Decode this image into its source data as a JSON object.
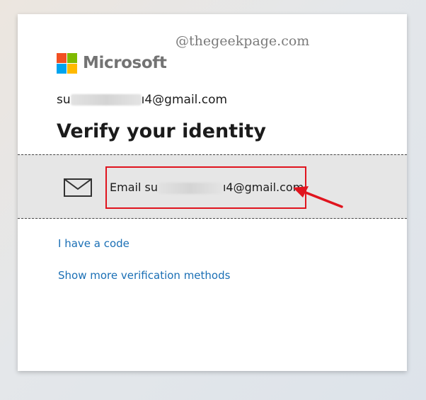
{
  "brand": {
    "name": "Microsoft"
  },
  "watermark": "@thegeekpage.com",
  "account": {
    "prefix": "su",
    "suffix": "ı4@gmail.com"
  },
  "title": "Verify your identity",
  "option": {
    "label_prefix": "Email su",
    "label_suffix": "ı4@gmail.com",
    "icon": "envelope-icon"
  },
  "links": {
    "have_code": "I have a code",
    "more_methods": "Show more verification methods"
  },
  "colors": {
    "link": "#1a6fb5",
    "highlight": "#e0141e",
    "row_bg": "#e6e6e6"
  }
}
